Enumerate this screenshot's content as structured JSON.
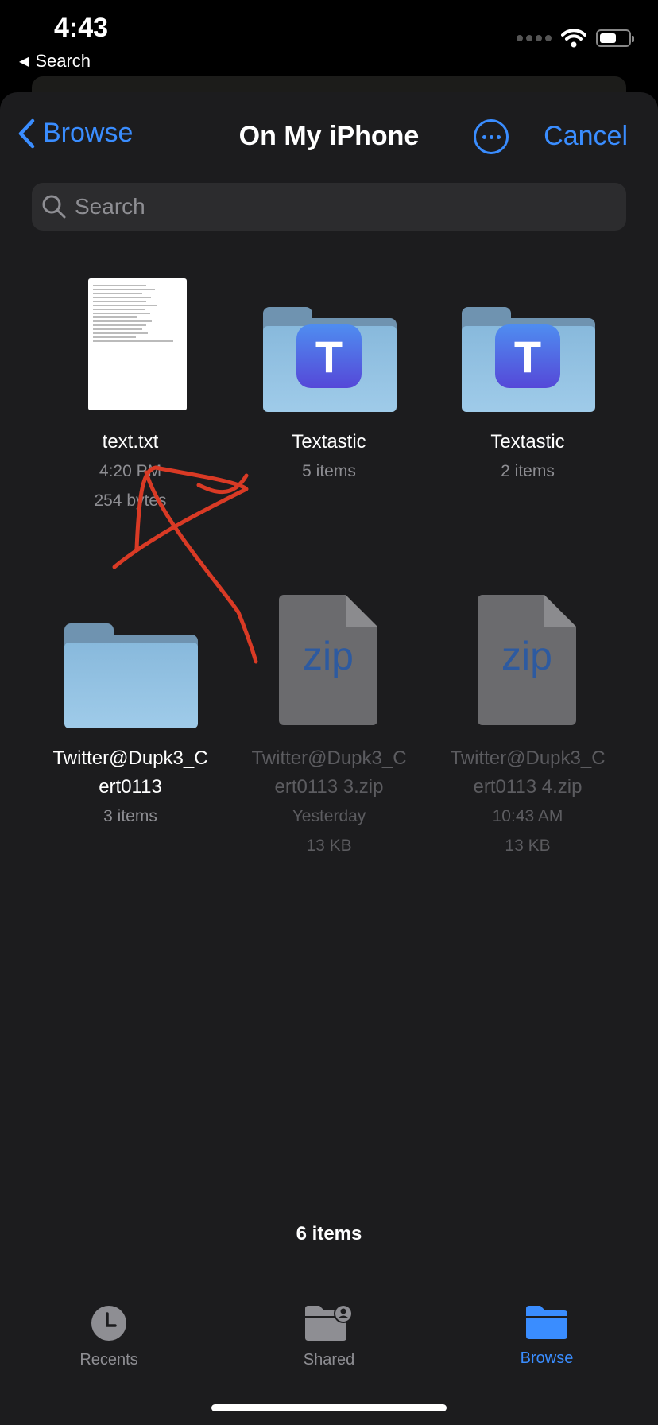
{
  "status_bar": {
    "time": "4:43",
    "back_app": "Search"
  },
  "nav": {
    "back_label": "Browse",
    "title": "On My iPhone",
    "cancel_label": "Cancel"
  },
  "search": {
    "placeholder": "Search"
  },
  "items": [
    {
      "name": "text.txt",
      "line1": "4:20 PM",
      "line2": "254 bytes",
      "kind": "text-document"
    },
    {
      "name": "Textastic",
      "line1": "5 items",
      "kind": "app-folder"
    },
    {
      "name": "Textastic",
      "line1": "2 items",
      "kind": "app-folder"
    },
    {
      "name": "Twitter@Dupk3_C\nert0113",
      "line1": "3 items",
      "kind": "folder"
    },
    {
      "name": "Twitter@Dupk3_C\nert0113 3.zip",
      "line1": "Yesterday",
      "line2": "13 KB",
      "kind": "zip",
      "badge": "zip"
    },
    {
      "name": "Twitter@Dupk3_C\nert0113 4.zip",
      "line1": "10:43 AM",
      "line2": "13 KB",
      "kind": "zip",
      "badge": "zip"
    }
  ],
  "app_badge_letter": "T",
  "footer": {
    "count": "6 items"
  },
  "tabs": [
    {
      "label": "Recents",
      "icon": "clock-icon",
      "active": false
    },
    {
      "label": "Shared",
      "icon": "shared-folder-icon",
      "active": false
    },
    {
      "label": "Browse",
      "icon": "folder-icon",
      "active": true
    }
  ],
  "colors": {
    "accent": "#3a8dff",
    "sheet": "#1c1c1e",
    "annotation": "#d93a25"
  }
}
